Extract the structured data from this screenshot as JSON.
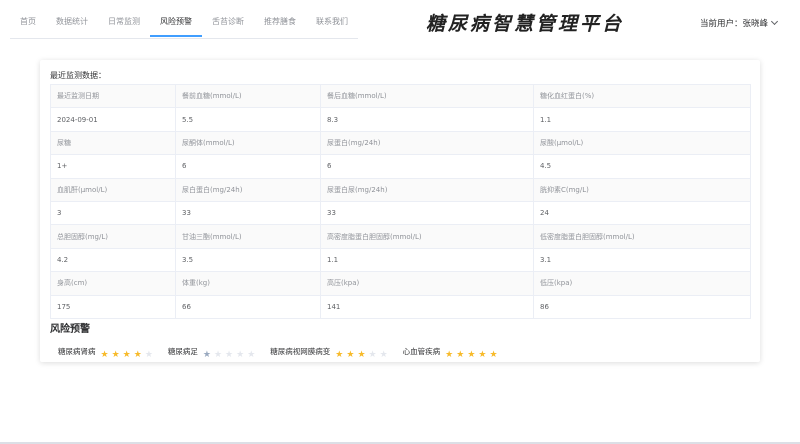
{
  "nav": {
    "items": [
      {
        "label": "首页",
        "name": "nav-home"
      },
      {
        "label": "数据统计",
        "name": "nav-statistics"
      },
      {
        "label": "日常监测",
        "name": "nav-monitoring"
      },
      {
        "label": "风险预警",
        "name": "nav-risk-warning",
        "active": true
      },
      {
        "label": "舌苔诊断",
        "name": "nav-tongue-diagnosis"
      },
      {
        "label": "推荐膳食",
        "name": "nav-diet"
      },
      {
        "label": "联系我们",
        "name": "nav-contact"
      }
    ]
  },
  "brand": "糖尿病智慧管理平台",
  "user": {
    "label": "当前用户：",
    "name": "张晓峰"
  },
  "panel": {
    "title": "最近监测数据："
  },
  "table": {
    "rows": [
      {
        "headers": [
          "最近监测日期",
          "餐前血糖(mmol/L)",
          "餐后血糖(mmol/L)",
          "糖化血红蛋白(%)"
        ],
        "values": [
          "2024-09-01",
          "5.5",
          "8.3",
          "1.1"
        ]
      },
      {
        "headers": [
          "尿糖",
          "尿酮体(mmol/L)",
          "尿蛋白(mg/24h)",
          "尿酸(μmol/L)"
        ],
        "values": [
          "1+",
          "6",
          "6",
          "4.5"
        ]
      },
      {
        "headers": [
          "血肌酐(μmol/L)",
          "尿白蛋白(mg/24h)",
          "尿蛋白尿(mg/24h)",
          "胱抑素C(mg/L)"
        ],
        "values": [
          "3",
          "33",
          "33",
          "24"
        ]
      },
      {
        "headers": [
          "总胆固醇(mg/L)",
          "甘油三酯(mmol/L)",
          "高密度脂蛋白胆固醇(mmol/L)",
          "低密度脂蛋白胆固醇(mmol/L)"
        ],
        "values": [
          "4.2",
          "3.5",
          "1.1",
          "3.1"
        ]
      },
      {
        "headers": [
          "身高(cm)",
          "体重(kg)",
          "高压(kpa)",
          "低压(kpa)"
        ],
        "values": [
          "175",
          "66",
          "141",
          "86"
        ]
      }
    ]
  },
  "risk": {
    "title": "风险预警",
    "items": [
      {
        "label": "糖尿病肾病",
        "rating": 4,
        "max": 5,
        "color": "#f7ba2a"
      },
      {
        "label": "糖尿病足",
        "rating": 1,
        "max": 5,
        "color": "#99a9bf"
      },
      {
        "label": "糖尿病视网膜病变",
        "rating": 3,
        "max": 5,
        "color": "#f7ba2a"
      },
      {
        "label": "心血管疾病",
        "rating": 5,
        "max": 5,
        "color": "#f7ba2a"
      }
    ]
  }
}
